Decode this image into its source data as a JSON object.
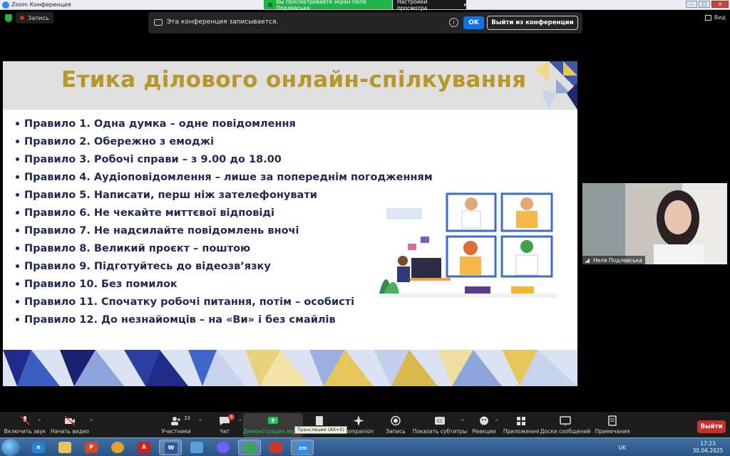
{
  "window": {
    "title": "Zoom Конференция"
  },
  "share_banner": {
    "text": "Вы просматриваете экран Неля Подлевська",
    "view_options": "Настройки просмотра"
  },
  "top_bar": {
    "recording_label": "Запись",
    "view_label": "Вид"
  },
  "recording_notice": {
    "message": "Эта конференция записывается.",
    "ok_label": "OK",
    "leave_label": "Выйти из конференции"
  },
  "slide": {
    "title": "Етика ділового онлайн-спілкування",
    "rules": [
      "Правило 1. Одна думка – одне повідомлення",
      "Правило 2. Обережно з емоджі",
      "Правило 3. Робочі справи – з 9.00 до 18.00",
      "Правило 4. Аудіоповідомлення – лише за попереднім погодженням",
      "Правило 5. Написати, перш ніж зателефонувати",
      "Правило 6. Не чекайте миттєвої відповіді",
      "Правило 7. Не надсилайте повідомлень вночі",
      "Правило 8. Великий проєкт – поштою",
      "Правило 9. Підготуйтесь до відеозв’язку",
      "Правило 10. Без помилок",
      "Правило 11. Спочатку робочі питання, потім – особисті",
      "Правило 12. До незнайомців – на «Ви» і без смайлів"
    ]
  },
  "participant": {
    "name": "Неля Подлевська"
  },
  "toolbar": {
    "mute": "Включить звук",
    "video": "Начать видео",
    "participants": "Участники",
    "participants_count": "33",
    "chat": "Чат",
    "chat_badge": "9",
    "share": "Демонстрация экрана",
    "companion": "Companion",
    "record": "Запись",
    "captions": "Показать субтитры",
    "reactions": "Реакции",
    "apps": "Приложения",
    "whiteboard": "Доски сообщений",
    "notes": "Примечания",
    "leave": "Выйти",
    "tooltip": "Трансляция (Alt+S)"
  },
  "taskbar": {
    "language": "UK",
    "time": "17:23",
    "date": "30.04.2025",
    "zoom_label": "zm"
  },
  "colors": {
    "title_gold": "#b5972a",
    "rule_navy": "#1e2a52",
    "zoom_blue": "#0e72ed",
    "share_green": "#23b24c",
    "end_red": "#c8302c"
  }
}
